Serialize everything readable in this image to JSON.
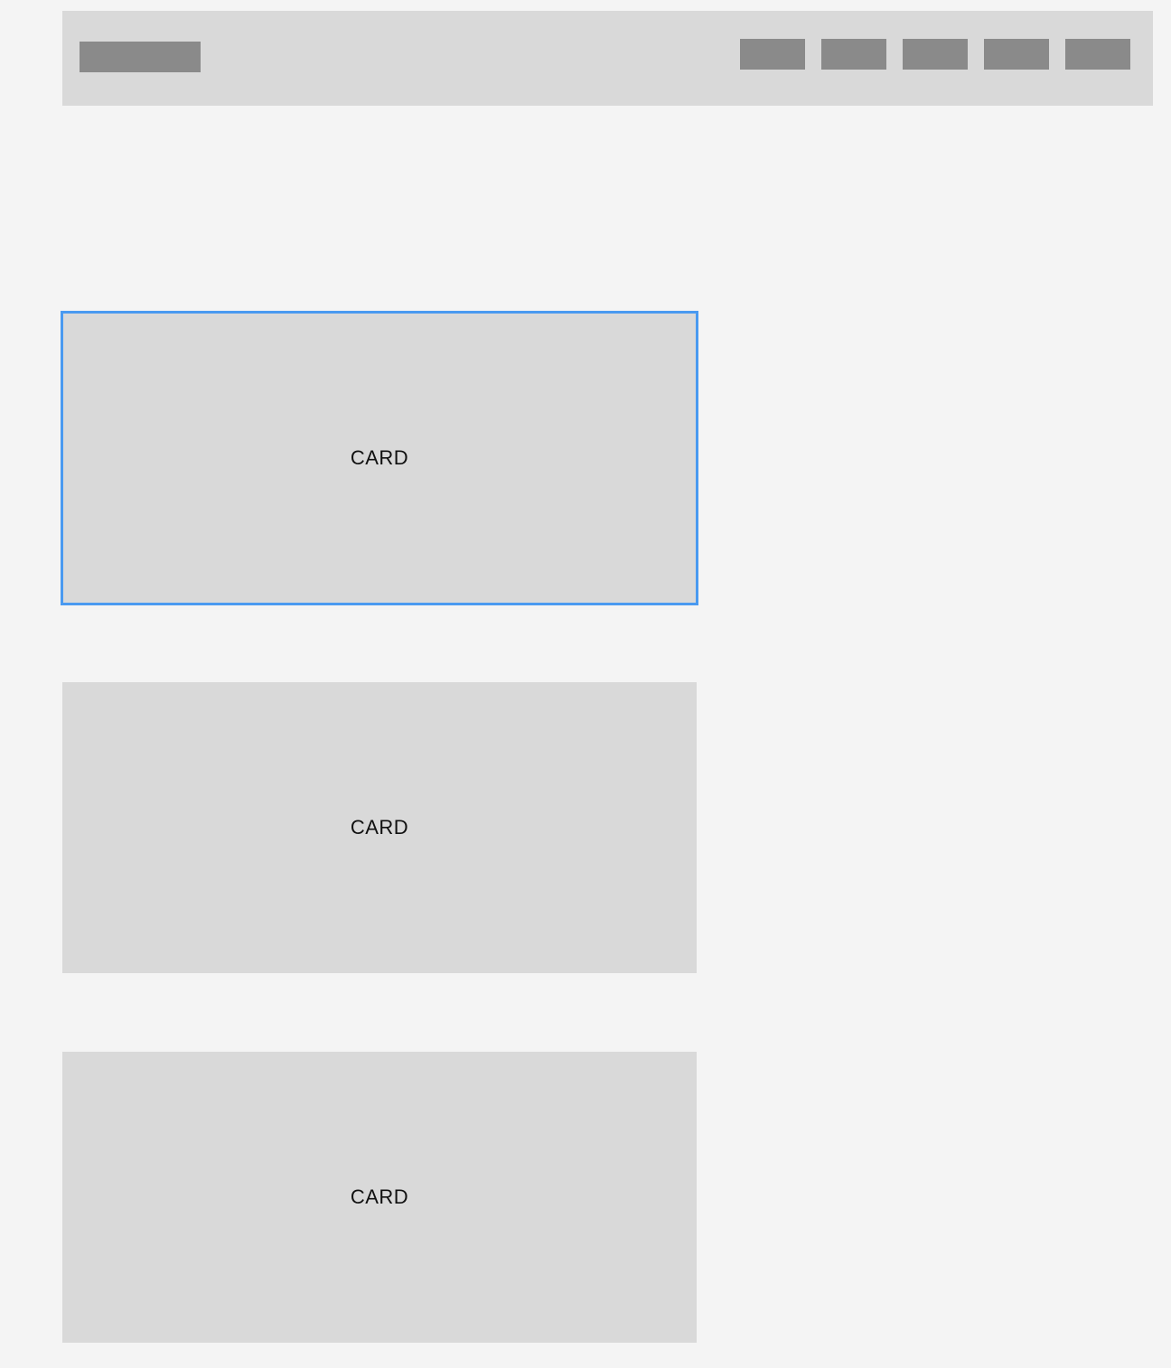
{
  "theme": {
    "page_background": "#f4f4f4",
    "block_color": "#d9d9d9",
    "placeholder_color": "#8a8a8a",
    "selection_color": "#4a9af0"
  },
  "header": {
    "logo": "logo-placeholder",
    "nav_items": [
      {
        "name": "nav-item-1"
      },
      {
        "name": "nav-item-2"
      },
      {
        "name": "nav-item-3"
      },
      {
        "name": "nav-item-4"
      },
      {
        "name": "nav-item-5"
      }
    ]
  },
  "cards": [
    {
      "label": "CARD",
      "selected": true
    },
    {
      "label": "CARD",
      "selected": false
    },
    {
      "label": "CARD",
      "selected": false
    }
  ]
}
